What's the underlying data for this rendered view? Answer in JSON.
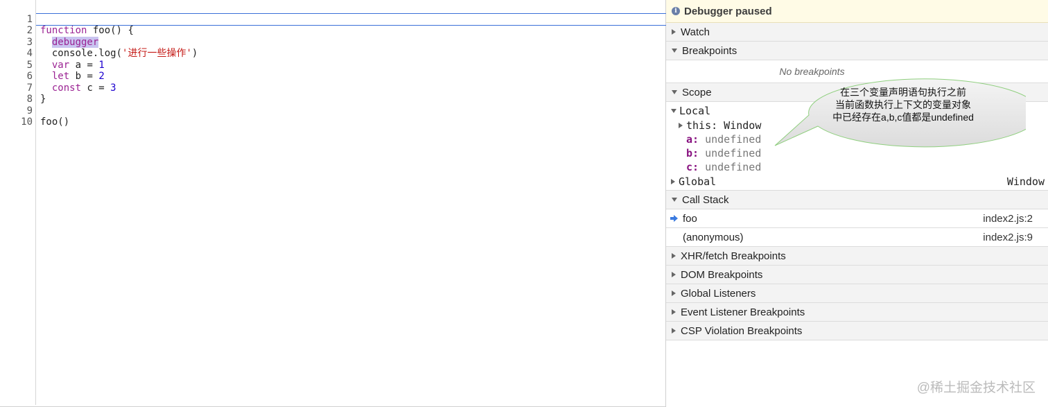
{
  "editor": {
    "line_numbers": [
      "1",
      "2",
      "3",
      "4",
      "5",
      "6",
      "7",
      "8",
      "9",
      "10"
    ],
    "lines": {
      "l1_kw": "function",
      "l1_rest": " foo() {",
      "l2_debugger": "debugger",
      "l3_pre": "console.log(",
      "l3_str": "'进行一些操作'",
      "l3_post": ")",
      "l4_kw": "var",
      "l4_mid": " a = ",
      "l4_num": "1",
      "l5_kw": "let",
      "l5_mid": " b = ",
      "l5_num": "2",
      "l6_kw": "const",
      "l6_mid": " c = ",
      "l6_num": "3",
      "l7": "}",
      "l9": "foo()"
    }
  },
  "sidebar": {
    "paused_banner": "Debugger paused",
    "sections": {
      "watch": "Watch",
      "breakpoints": "Breakpoints",
      "no_breakpoints": "No breakpoints",
      "scope": "Scope",
      "call_stack": "Call Stack",
      "xhr": "XHR/fetch Breakpoints",
      "dom": "DOM Breakpoints",
      "global_listeners": "Global Listeners",
      "event_listener": "Event Listener Breakpoints",
      "csp": "CSP Violation Breakpoints"
    },
    "scope": {
      "local": "Local",
      "this_key": "this:",
      "this_val": " Window",
      "a_key": "a:",
      "b_key": "b:",
      "c_key": "c:",
      "undef": " undefined",
      "global": "Global",
      "global_val": "Window"
    },
    "call_stack": [
      {
        "name": "foo",
        "location": "index2.js:2"
      },
      {
        "name": "(anonymous)",
        "location": "index2.js:9"
      }
    ]
  },
  "callout": {
    "line1": "在三个变量声明语句执行之前",
    "line2": "当前函数执行上下文的变量对象",
    "line3": "中已经存在a,b,c值都是undefined"
  },
  "watermark": "@稀土掘金技术社区"
}
